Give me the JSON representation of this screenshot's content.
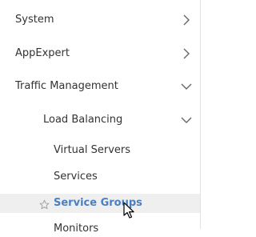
{
  "nav": {
    "items": [
      {
        "label": "System",
        "icon": "chevron-right-icon"
      },
      {
        "label": "AppExpert",
        "icon": "chevron-right-icon"
      },
      {
        "label": "Traffic Management",
        "icon": "chevron-down-icon"
      },
      {
        "label": "Load Balancing",
        "icon": "chevron-down-icon"
      },
      {
        "label": "Virtual Servers"
      },
      {
        "label": "Services"
      },
      {
        "label": "Service Groups",
        "icon": "star-outline-icon",
        "selected": true
      },
      {
        "label": "Monitors"
      }
    ]
  },
  "colors": {
    "selected_text": "#4a7fc2",
    "selected_bg": "#efefef",
    "text": "#333333",
    "chevron": "#666666"
  }
}
